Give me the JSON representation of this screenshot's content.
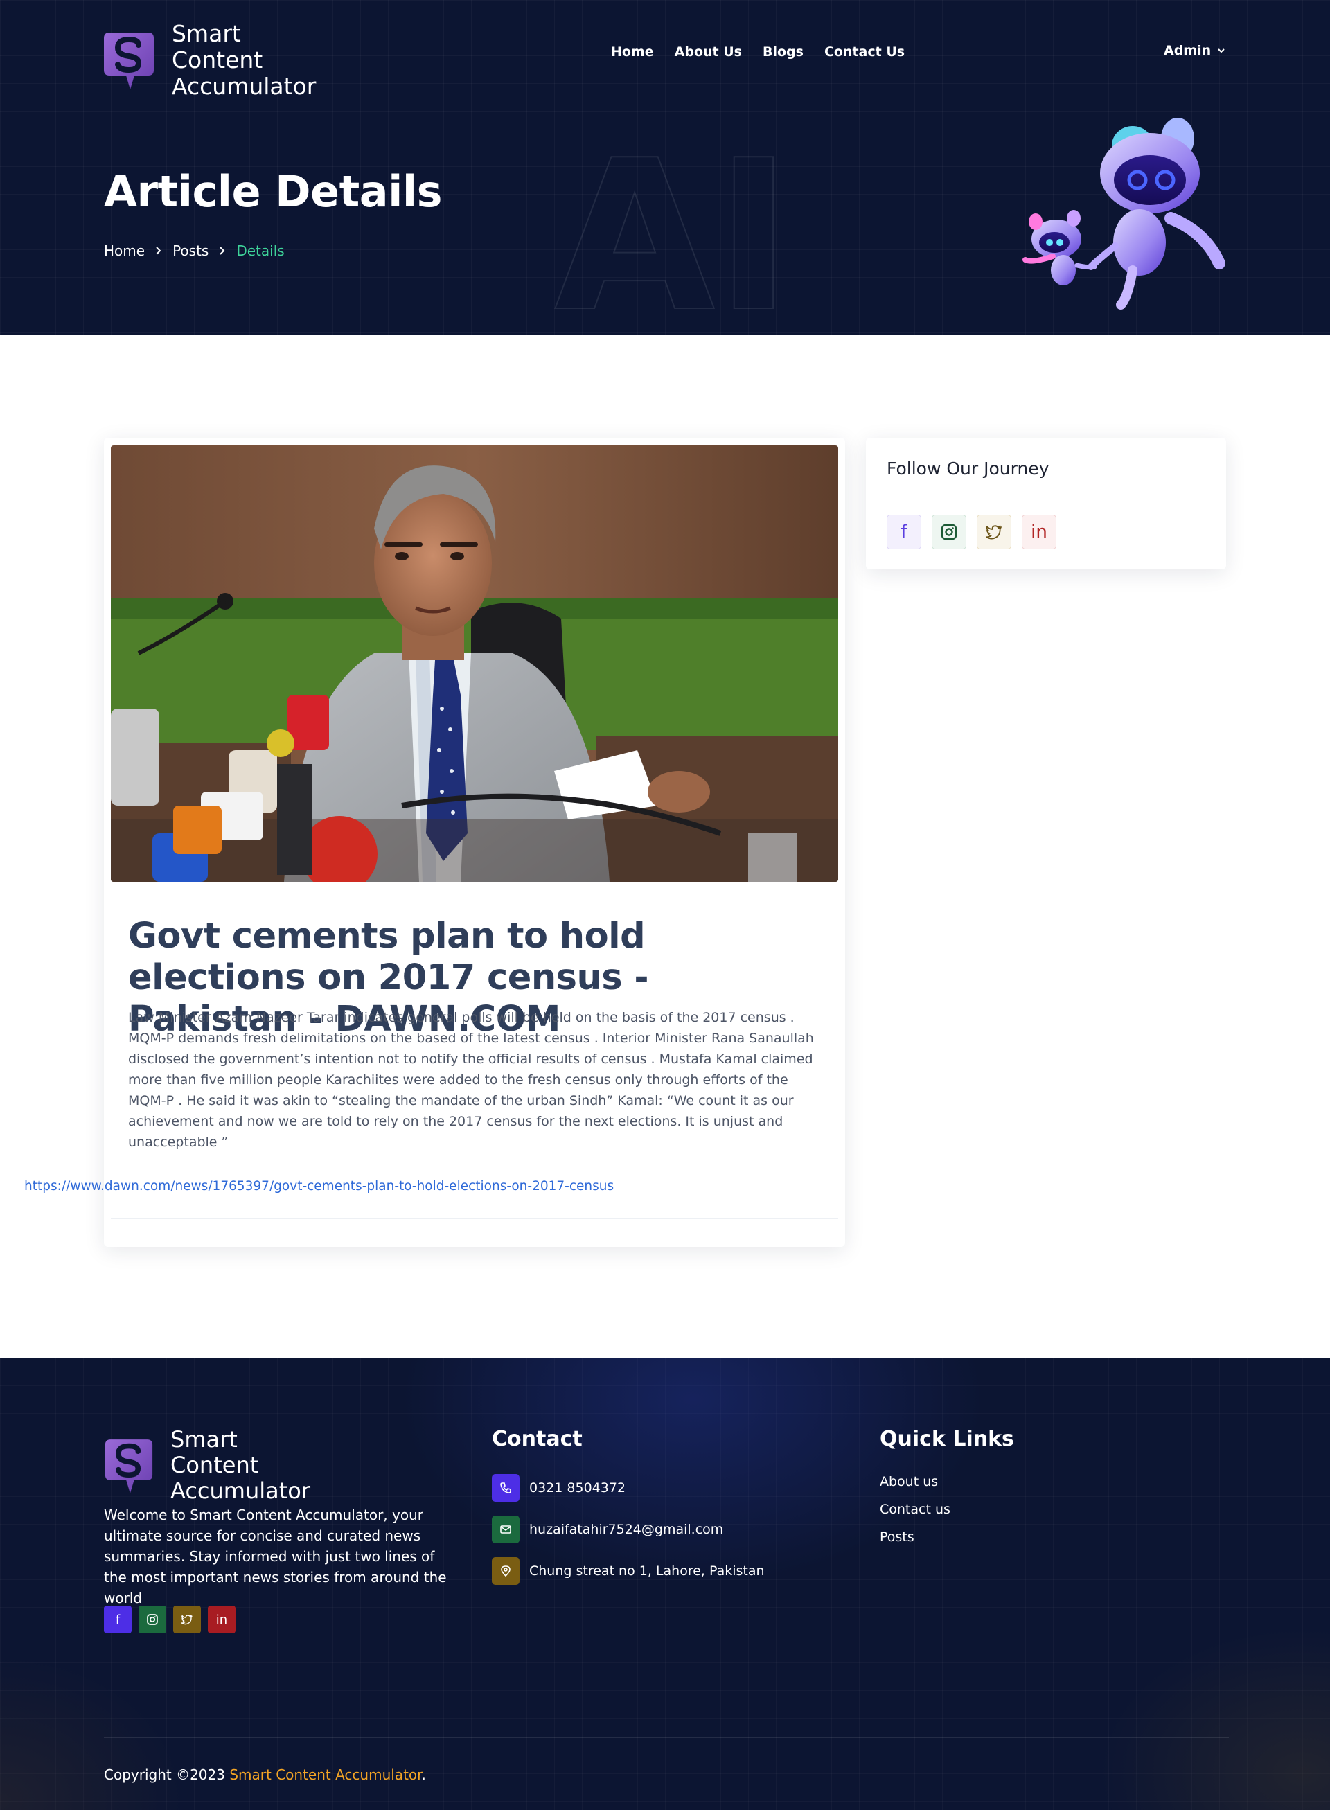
{
  "header": {
    "brand": "Smart Content Accumulator",
    "nav": [
      "Home",
      "About Us",
      "Blogs",
      "Contact Us"
    ],
    "user_menu": "Admin",
    "watermark": "AI"
  },
  "hero": {
    "title": "Article Details",
    "breadcrumb": [
      "Home",
      "Posts",
      "Details"
    ]
  },
  "article": {
    "image_icon": "news-photo-press-conference",
    "title": "Govt cements plan to hold elections on 2017 census - Pakistan - DAWN.COM",
    "body": "Law Minister Azam Nazeer Tarar indicates general polls will be held on the basis of the 2017 census . MQM-P demands fresh delimitations on the based of the latest census . Interior Minister Rana Sanaullah disclosed the government’s intention not to notify the official results of census . Mustafa Kamal claimed more than five million people Karachiites were added to the fresh census only through efforts of the MQM-P . He said it was akin to “stealing the mandate of the urban Sindh” Kamal: “We count it as our achievement and now we are told to rely on the 2017 census for the next elections. It is unjust and unacceptable ”",
    "link": "https://www.dawn.com/news/1765397/govt-cements-plan-to-hold-elections-on-2017-census"
  },
  "sidebar": {
    "title": "Follow Our Journey",
    "social": [
      {
        "icon": "facebook-icon",
        "glyph": "f"
      },
      {
        "icon": "instagram-icon",
        "glyph": ""
      },
      {
        "icon": "twitter-icon",
        "glyph": ""
      },
      {
        "icon": "linkedin-icon",
        "glyph": "in"
      }
    ]
  },
  "footer": {
    "brand": "Smart Content Accumulator",
    "about": "Welcome to Smart Content Accumulator, your ultimate source for concise and curated news summaries. Stay informed with just two lines of the most important news stories from around the world",
    "contact_heading": "Contact",
    "phone": "0321 8504372",
    "email": "huzaifatahir7524@gmail.com",
    "address": "Chung streat no 1, Lahore, Pakistan",
    "quick_links_heading": "Quick Links",
    "quick_links": [
      "About us",
      "Contact us",
      "Posts"
    ],
    "copyright_prefix": "Copyright ©2023",
    "copyright_brand": "Smart Content Accumulator",
    "copyright_suffix": "."
  },
  "colors": {
    "navy": "#0c1532",
    "accent_green": "#3ed49a",
    "brand_purple": "#7b4fc4",
    "link_blue": "#2f6ad8",
    "copyright_orange": "#f5a524"
  }
}
